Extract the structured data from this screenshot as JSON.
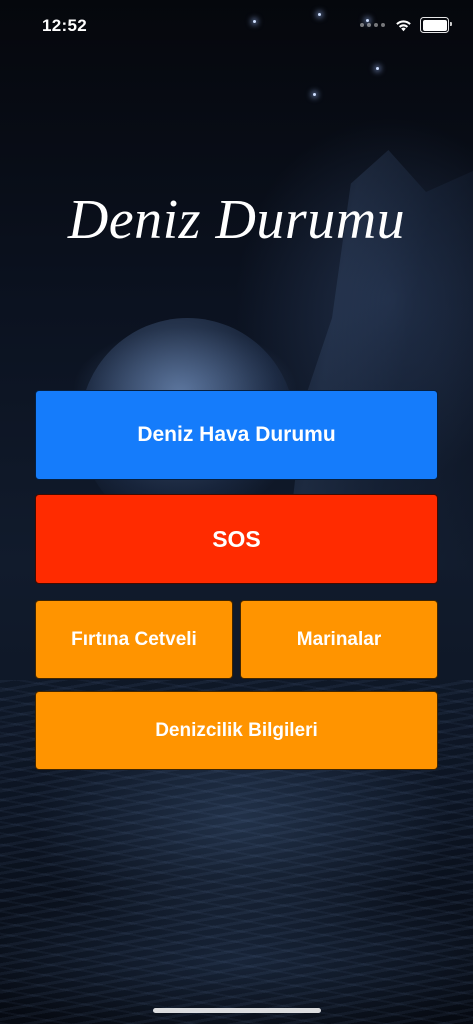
{
  "status_bar": {
    "time": "12:52",
    "icons": [
      "wifi-icon",
      "battery-icon"
    ]
  },
  "app": {
    "title": "Deniz Durumu"
  },
  "buttons": {
    "weather": "Deniz Hava Durumu",
    "sos": "SOS",
    "storm_scale": "Fırtına Cetveli",
    "marinas": "Marinalar",
    "seamanship": "Denizcilik Bilgileri"
  },
  "colors": {
    "blue": "#157cfb",
    "red": "#ff2b00",
    "orange": "#ff9400"
  }
}
